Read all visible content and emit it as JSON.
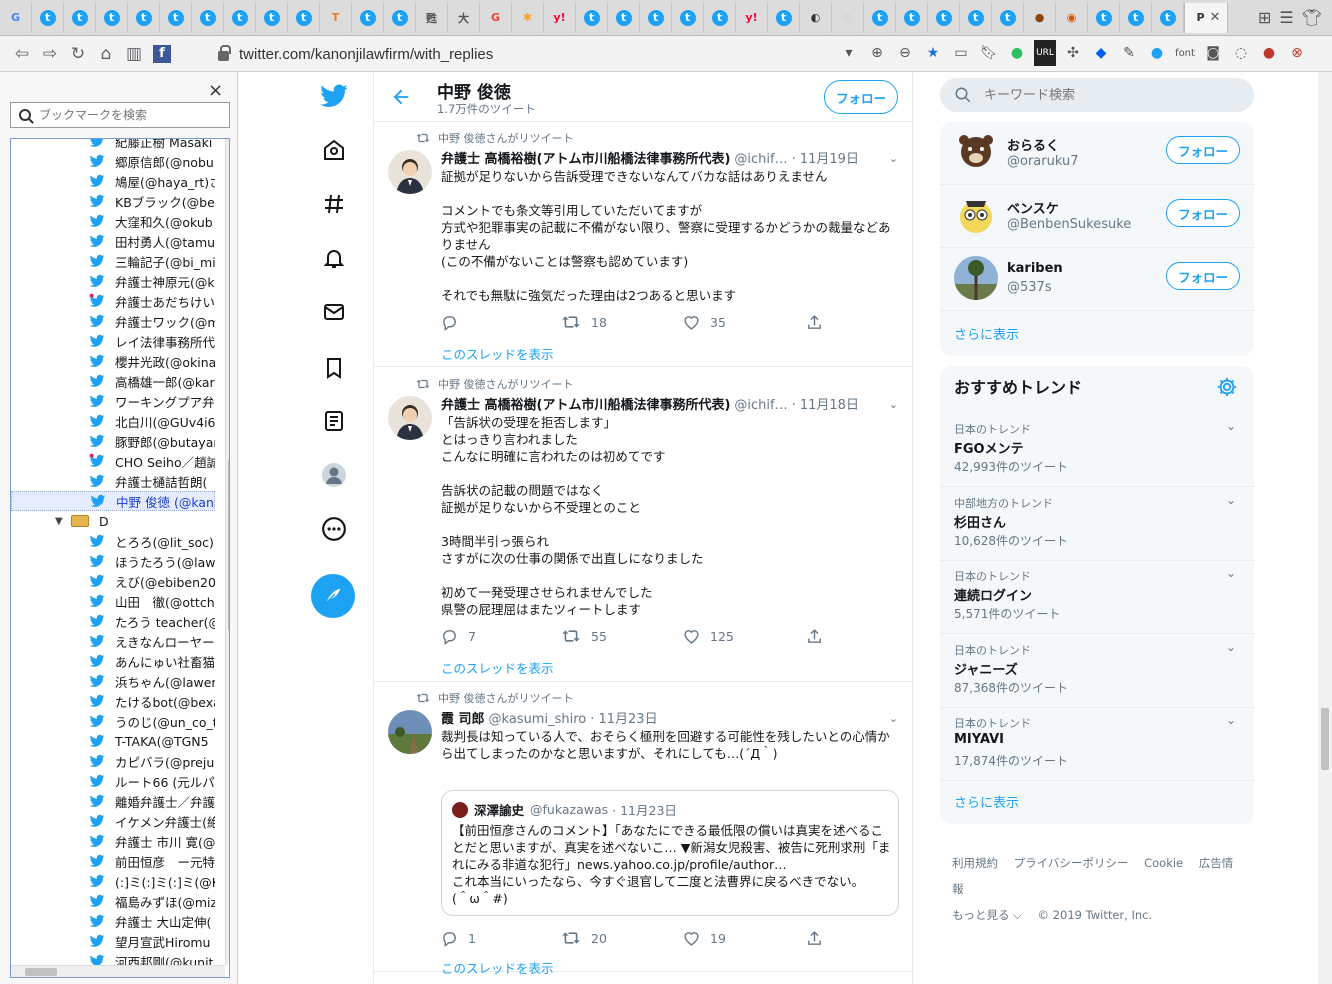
{
  "browser": {
    "url": "twitter.com/kanonjilawfirm/with_replies",
    "tab_glyphs": [
      "G",
      "t",
      "t",
      "t",
      "t",
      "t",
      "t",
      "t",
      "t",
      "t",
      "T",
      "t",
      "t",
      "甦",
      "大",
      "G",
      "✱",
      "y!",
      "t",
      "t",
      "t",
      "t",
      "t",
      "y!",
      "t",
      "◐",
      "◎",
      "t",
      "t",
      "t",
      "t",
      "t",
      "●",
      "◉",
      "t",
      "t",
      "t"
    ],
    "tab_colors": [
      "#4285f4",
      "#1da1f2",
      "#1da1f2",
      "#1da1f2",
      "#1da1f2",
      "#1da1f2",
      "#1da1f2",
      "#1da1f2",
      "#1da1f2",
      "#1da1f2",
      "#e67e22",
      "#1da1f2",
      "#1da1f2",
      "#555555",
      "#555555",
      "#ea4335",
      "#f5a623",
      "#ff0033",
      "#1da1f2",
      "#1da1f2",
      "#1da1f2",
      "#1da1f2",
      "#1da1f2",
      "#ff0033",
      "#1da1f2",
      "#333333",
      "#cccccc",
      "#1da1f2",
      "#1da1f2",
      "#1da1f2",
      "#1da1f2",
      "#1da1f2",
      "#8b4513",
      "#d35400",
      "#1da1f2",
      "#1da1f2",
      "#1da1f2"
    ],
    "active_tab_glyph": "P"
  },
  "bookmarks": {
    "search_placeholder": "ブックマークを検索",
    "items": [
      {
        "label": "紀藤正樹 Masaki",
        "type": "bird"
      },
      {
        "label": "郷原信郎(@nobu",
        "type": "bird"
      },
      {
        "label": "鳩屋(@haya_rt)さ",
        "type": "bird"
      },
      {
        "label": "KBブラック(@ben",
        "type": "bird"
      },
      {
        "label": "大窪和久(@okub",
        "type": "bird"
      },
      {
        "label": "田村勇人(@tamu",
        "type": "bird"
      },
      {
        "label": "三輪記子(@bi_mi",
        "type": "bird"
      },
      {
        "label": "弁護士神原元(@k",
        "type": "bird"
      },
      {
        "label": "弁護士あだちけい",
        "type": "bird-red"
      },
      {
        "label": "弁護士ワック(@ma",
        "type": "bird"
      },
      {
        "label": "レイ法律事務所代",
        "type": "bird"
      },
      {
        "label": "櫻井光政(@okina",
        "type": "bird"
      },
      {
        "label": "高橋雄一郎(@kar",
        "type": "bird"
      },
      {
        "label": "ワーキングプア弁護",
        "type": "bird"
      },
      {
        "label": "北白川(@GUv4i6",
        "type": "bird"
      },
      {
        "label": "豚野郎(@butayar",
        "type": "bird"
      },
      {
        "label": "CHO Seiho／趙誠",
        "type": "bird-red"
      },
      {
        "label": "弁護士樋詰哲朗(",
        "type": "bird"
      },
      {
        "label": "中野 俊徳 (@kano",
        "type": "bird",
        "selected": true
      },
      {
        "label": "D",
        "type": "folder"
      },
      {
        "label": "とろろ(@lit_soc)さ",
        "type": "bird"
      },
      {
        "label": "ほうたろう(@lawye",
        "type": "bird"
      },
      {
        "label": "えび(@ebiben200",
        "type": "bird"
      },
      {
        "label": "山田　徹(@ottch",
        "type": "bird"
      },
      {
        "label": "たろう teacher(@",
        "type": "bird"
      },
      {
        "label": "えきなんローヤー",
        "type": "bird"
      },
      {
        "label": "あんにゅい社畜猫(",
        "type": "bird"
      },
      {
        "label": "浜ちゃん(@lawer_",
        "type": "bird"
      },
      {
        "label": "たけるbot(@bexa",
        "type": "bird"
      },
      {
        "label": "うのじ(@un_co_t",
        "type": "bird"
      },
      {
        "label": "T-TAKA(@TGN5",
        "type": "bird"
      },
      {
        "label": "カピバラ(@prejur",
        "type": "bird"
      },
      {
        "label": "ルート66 (元ルパ",
        "type": "bird"
      },
      {
        "label": "離婚弁護士／弁護",
        "type": "bird"
      },
      {
        "label": "イケメン弁護士(絶",
        "type": "bird"
      },
      {
        "label": "弁護士 市川 寛(@",
        "type": "bird"
      },
      {
        "label": "前田恒彦　ー元特",
        "type": "bird"
      },
      {
        "label": "(:]ミ(:]ミ(:]ミ(@K",
        "type": "bird"
      },
      {
        "label": "福島みずほ(@miz",
        "type": "bird"
      },
      {
        "label": "弁護士 大山定伸(",
        "type": "bird"
      },
      {
        "label": "望月宣武Hiromu",
        "type": "bird"
      },
      {
        "label": "河西邦剛(@kunit",
        "type": "bird"
      }
    ]
  },
  "twitter_nav": [
    "twitter-logo",
    "home",
    "explore",
    "notifications",
    "messages",
    "bookmarks",
    "lists",
    "profile",
    "more"
  ],
  "header": {
    "name": "中野 俊徳",
    "tweet_count": "1.7万件のツイート",
    "follow_label": "フォロー"
  },
  "tweets": [
    {
      "retweeted_by": "中野 俊徳さんがリツイート",
      "name": "弁護士 高橋裕樹(アトム市川船橋法律事務所代表)",
      "handle": "@ichif…",
      "date": "· 11月19日",
      "body": "証拠が足りないから告訴受理できないなんてバカな話はありえません\n\nコメントでも条文等引用していただいてますが\n方式や犯罪事実の記載に不備がない限り、警察に受理するかどうかの裁量などありません\n(この不備がないことは警察も認めています)\n\nそれでも無駄に強気だった理由は2つあると思います",
      "reply_count": "",
      "retweet_count": "18",
      "like_count": "35",
      "show_thread": "このスレッドを表示"
    },
    {
      "retweeted_by": "中野 俊徳さんがリツイート",
      "name": "弁護士 高橋裕樹(アトム市川船橋法律事務所代表)",
      "handle": "@ichif…",
      "date": "· 11月18日",
      "body": "「告訴状の受理を拒否します」\nとはっきり言われました\nこんなに明確に言われたのは初めてです\n\n告訴状の記載の問題ではなく\n証拠が足りないから不受理とのこと\n\n3時間半引っ張られ\nさすがに次の仕事の関係で出直しになりました\n\n初めて一発受理させられませんでした\n県警の屁理屈はまたツィートします",
      "reply_count": "7",
      "retweet_count": "55",
      "like_count": "125",
      "show_thread": "このスレッドを表示"
    },
    {
      "retweeted_by": "中野 俊徳さんがリツイート",
      "name": "霞 司郎",
      "handle": "@kasumi_shiro",
      "date": "· 11月23日",
      "body": "裁判長は知っている人で、おそらく極刑を回避する可能性を残したいとの心情から出てしまったのかなと思いますが、それにしても…(´Д｀)",
      "quote": {
        "name": "深澤諭史",
        "handle": "@fukazawas",
        "date": "· 11月23日",
        "body": "【前田恒彦さんのコメント】「あなたにできる最低限の償いは真実を述べることだと思いますが、真実を述べないこ… ▼新潟女児殺害、被告に死刑求刑「まれにみる非道な犯行」news.yahoo.co.jp/profile/author…\nこれ本当にいったなら、今すぐ退官して二度と法曹界に戻るべきでない。\n(＾ω＾#)"
      },
      "reply_count": "1",
      "retweet_count": "20",
      "like_count": "19",
      "show_thread": "このスレッドを表示"
    }
  ],
  "right": {
    "search_placeholder": "キーワード検索",
    "who_to_follow": [
      {
        "name": "おらるく",
        "handle": "@oraruku7",
        "follow": "フォロー"
      },
      {
        "name": "ベンスケ",
        "handle": "@BenbenSukesuke",
        "follow": "フォロー"
      },
      {
        "name": "kariben",
        "handle": "@537s",
        "follow": "フォロー"
      }
    ],
    "show_more": "さらに表示",
    "trends_title": "おすすめトレンド",
    "trends": [
      {
        "category": "日本のトレンド",
        "name": "FGOメンテ",
        "count": "42,993件のツイート"
      },
      {
        "category": "中部地方のトレンド",
        "name": "杉田さん",
        "count": "10,628件のツイート"
      },
      {
        "category": "日本のトレンド",
        "name": "連続ログイン",
        "count": "5,571件のツイート"
      },
      {
        "category": "日本のトレンド",
        "name": "ジャニーズ",
        "count": "87,368件のツイート"
      },
      {
        "category": "日本のトレンド",
        "name": "MIYAVI",
        "count": "17,874件のツイート"
      }
    ],
    "trends_more": "さらに表示",
    "footer": {
      "terms": "利用規約",
      "privacy": "プライバシーポリシー",
      "cookie": "Cookie",
      "ads": "広告情報",
      "more": "もっと見る ⌵",
      "copyright": "© 2019 Twitter, Inc."
    }
  },
  "colors": {
    "twitter_blue": "#1da1f2",
    "muted_text": "#657786"
  }
}
